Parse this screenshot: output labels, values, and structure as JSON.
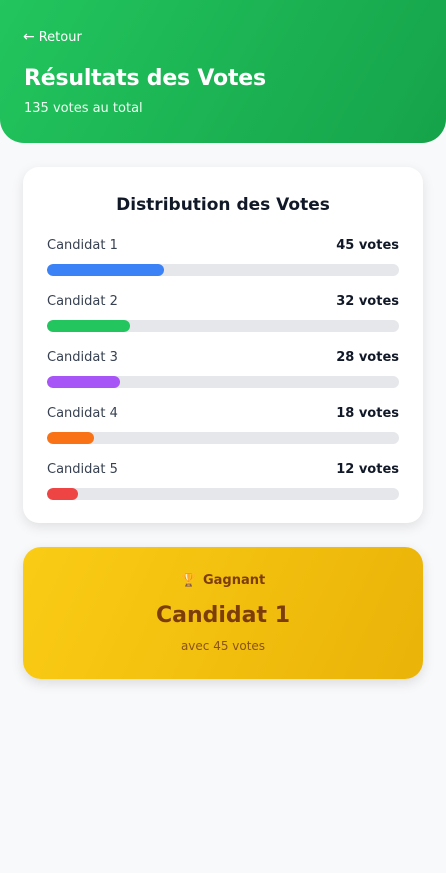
{
  "header": {
    "back_label": "Retour",
    "back_arrow": "←",
    "title": "Résultats des Votes",
    "subtitle": "135 votes au total",
    "gradient_start": "#22c55e",
    "gradient_end": "#16a34a"
  },
  "distribution": {
    "title": "Distribution des Votes",
    "total_votes": 135,
    "items": [
      {
        "label": "Candidat 1",
        "votes_text": "45 votes",
        "votes": 45,
        "color": "#3b82f6"
      },
      {
        "label": "Candidat 2",
        "votes_text": "32 votes",
        "votes": 32,
        "color": "#22c55e"
      },
      {
        "label": "Candidat 3",
        "votes_text": "28 votes",
        "votes": 28,
        "color": "#a855f7"
      },
      {
        "label": "Candidat 4",
        "votes_text": "18 votes",
        "votes": 18,
        "color": "#f97316"
      },
      {
        "label": "Candidat 5",
        "votes_text": "12 votes",
        "votes": 12,
        "color": "#ef4444"
      }
    ]
  },
  "winner": {
    "icon": "trophy-icon",
    "icon_glyph": "🏆",
    "badge_label": "Gagnant",
    "name": "Candidat 1",
    "votes_text": "avec 45 votes"
  }
}
